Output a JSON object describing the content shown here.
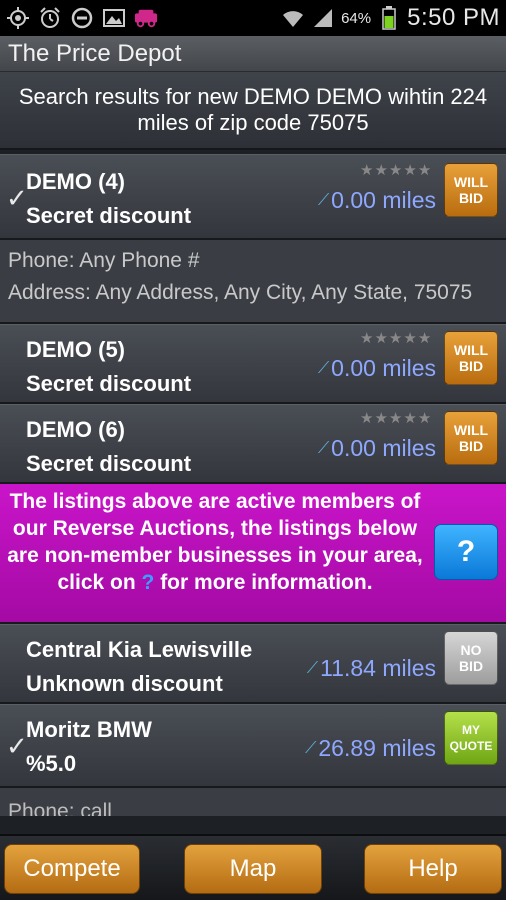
{
  "status_bar": {
    "icons_left": [
      "gps-icon",
      "alarm-icon",
      "block-icon",
      "image-icon",
      "car-icon"
    ],
    "battery_percent": "64%",
    "time": "5:50 PM"
  },
  "app": {
    "title": "The Price Depot"
  },
  "search": {
    "summary": "Search results for new DEMO DEMO wihtin 224 miles of zip code 75075"
  },
  "members": [
    {
      "name": "DEMO (4)",
      "discount": "Secret discount",
      "distance": "0.00 miles",
      "badge_line1": "WILL",
      "badge_line2": "BID",
      "checked": true
    },
    {
      "name": "DEMO (5)",
      "discount": "Secret discount",
      "distance": "0.00 miles",
      "badge_line1": "WILL",
      "badge_line2": "BID",
      "checked": false
    },
    {
      "name": "DEMO (6)",
      "discount": "Secret discount",
      "distance": "0.00 miles",
      "badge_line1": "WILL",
      "badge_line2": "BID",
      "checked": false
    }
  ],
  "expanded_details": {
    "phone": "Phone: Any Phone #",
    "address": "Address: Any Address, Any City, Any State, 75075"
  },
  "info_banner": {
    "text_before": "The listings above are active members of our Reverse Auctions, the listings below are non-member businesses in your area, click on",
    "qmark": "?",
    "text_after": "for more information.",
    "help_button": "?"
  },
  "non_members": [
    {
      "name": "Central Kia Lewisville",
      "discount": "Unknown discount",
      "distance": "11.84 miles",
      "badge_line1": "NO",
      "badge_line2": "BID",
      "checked": false
    },
    {
      "name": "Moritz BMW",
      "discount": "%5.0",
      "distance": "26.89 miles",
      "badge_line1": "MY",
      "badge_line2": "QUOTE",
      "checked": true
    }
  ],
  "partial_text": "Phone: call",
  "bottom_bar": {
    "compete": "Compete",
    "map": "Map",
    "help": "Help"
  },
  "colors": {
    "orange_badge": "#d08a24",
    "magenta_banner": "#b80fb8",
    "distance_text": "#8fa8ff",
    "help_blue": "#1a8ee8"
  }
}
